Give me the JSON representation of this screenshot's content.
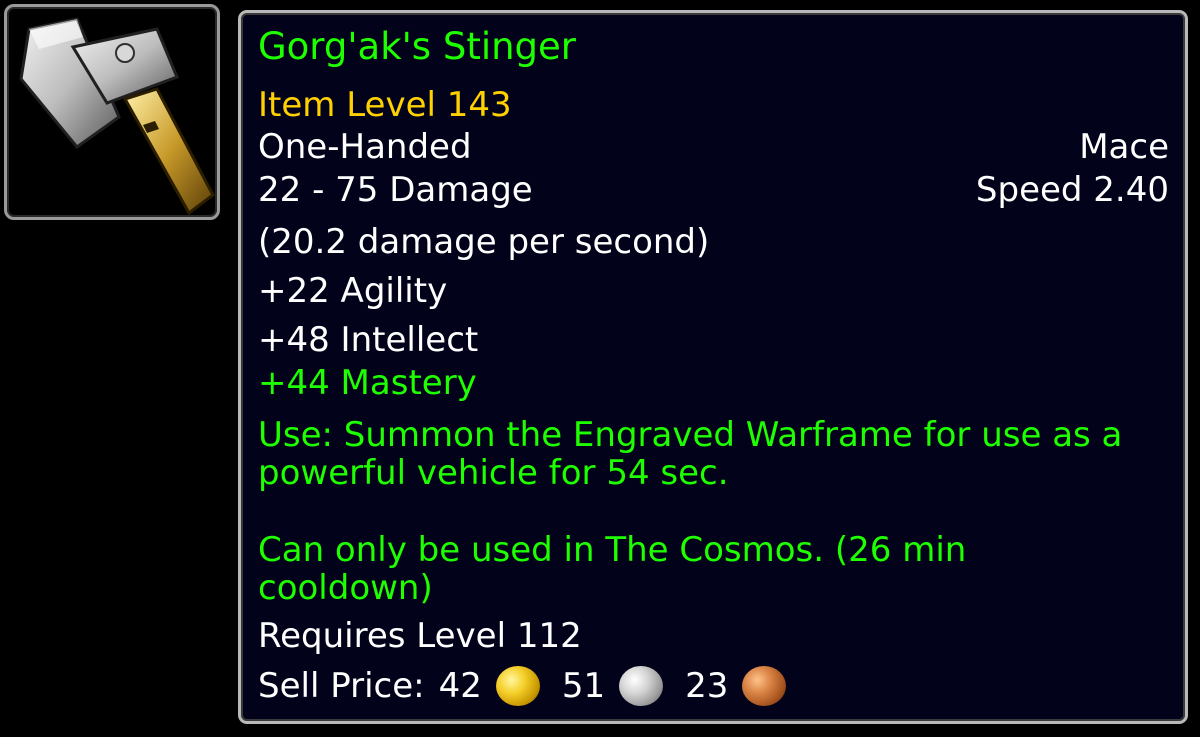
{
  "item": {
    "icon": "mace-icon",
    "name": "Gorg'ak's Stinger",
    "item_level": "Item Level 143",
    "slot": "One-Handed",
    "type": "Mace",
    "damage": "22 - 75 Damage",
    "speed": "Speed 2.40",
    "dps": "(20.2 damage per second)",
    "stats": [
      "+22 Agility",
      "+48 Intellect"
    ],
    "secondary_stat": "+44 Mastery",
    "use_line1": "Use: Summon the Engraved Warframe for use as a",
    "use_line2": "powerful vehicle for 54 sec.",
    "restriction_line1": "Can only be used in The Cosmos. (26 min",
    "restriction_line2": "cooldown)",
    "requires": "Requires Level 112",
    "sell_label": "Sell Price:",
    "sell_gold": "42",
    "sell_silver": "51",
    "sell_copper": "23"
  },
  "colors": {
    "name": "#1eff00",
    "item_level": "#ffd100",
    "text": "#ffffff",
    "effect": "#1eff00",
    "background": "#02031a"
  }
}
